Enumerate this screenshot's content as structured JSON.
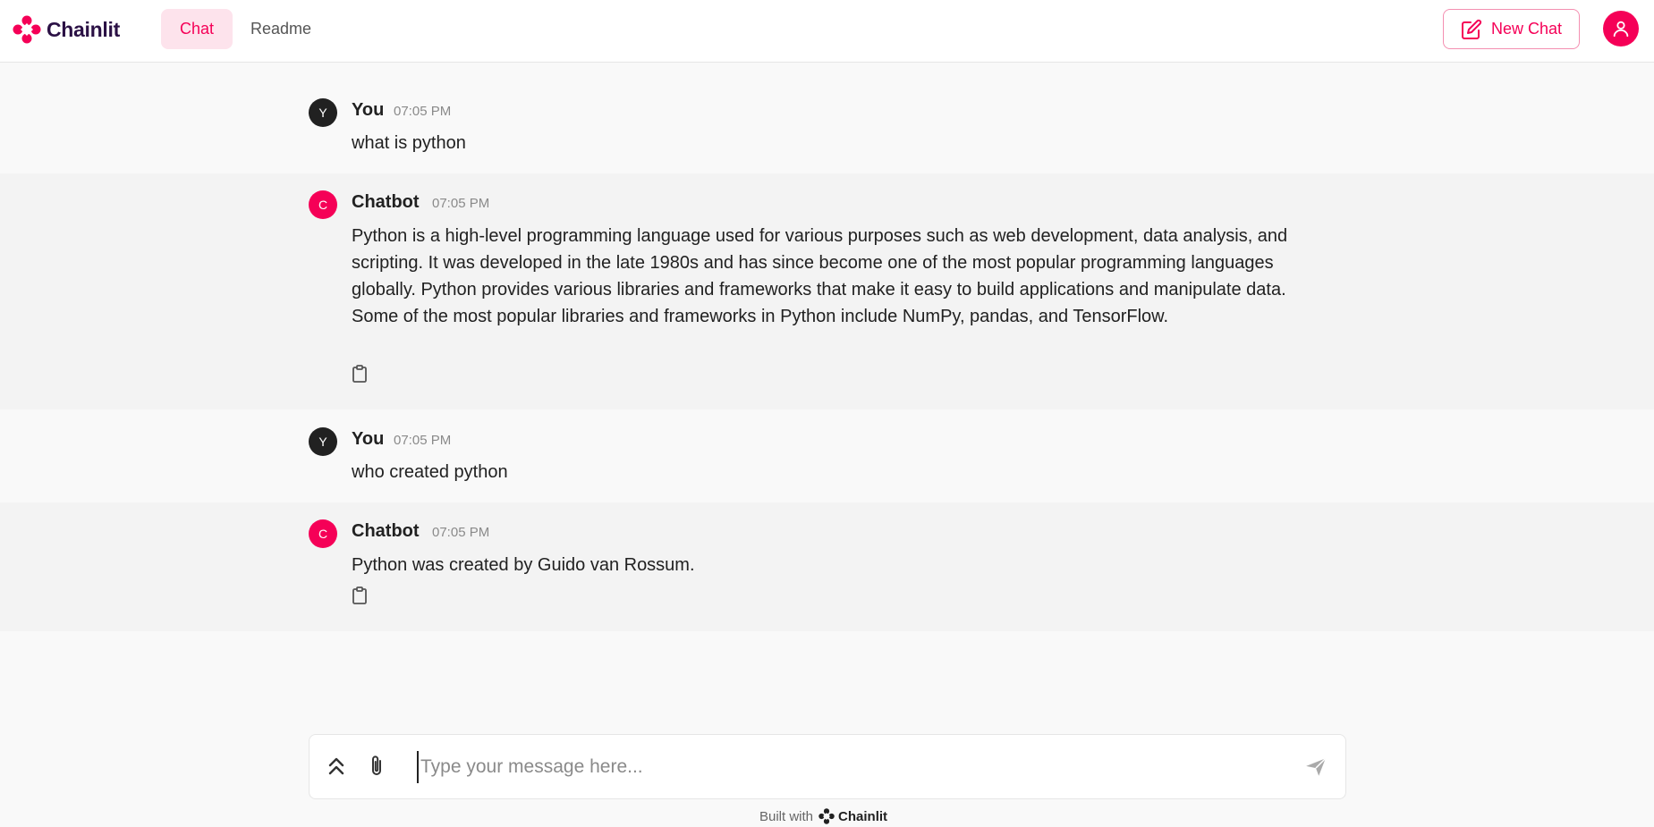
{
  "header": {
    "logo_text": "Chainlit",
    "tabs": [
      "Chat",
      "Readme"
    ],
    "new_chat_label": "New Chat",
    "accent_color": "#f50057"
  },
  "messages": [
    {
      "role": "user",
      "avatar_letter": "Y",
      "author": "You",
      "time": "07:05 PM",
      "text": "what is python"
    },
    {
      "role": "bot",
      "avatar_letter": "C",
      "author": "Chatbot",
      "time": "07:05 PM",
      "text": "Python is a high-level programming language used for various purposes such as web development, data analysis, and scripting. It was developed in the late 1980s and has since become one of the most popular programming languages globally. Python provides various libraries and frameworks that make it easy to build applications and manipulate data. Some of the most popular libraries and frameworks in Python include NumPy, pandas, and TensorFlow."
    },
    {
      "role": "user",
      "avatar_letter": "Y",
      "author": "You",
      "time": "07:05 PM",
      "text": "who created python"
    },
    {
      "role": "bot",
      "avatar_letter": "C",
      "author": "Chatbot",
      "time": "07:05 PM",
      "text": "Python was created by Guido van Rossum."
    }
  ],
  "composer": {
    "placeholder": "Type your message here..."
  },
  "footer": {
    "built_with": "Built with",
    "brand": "Chainlit"
  }
}
